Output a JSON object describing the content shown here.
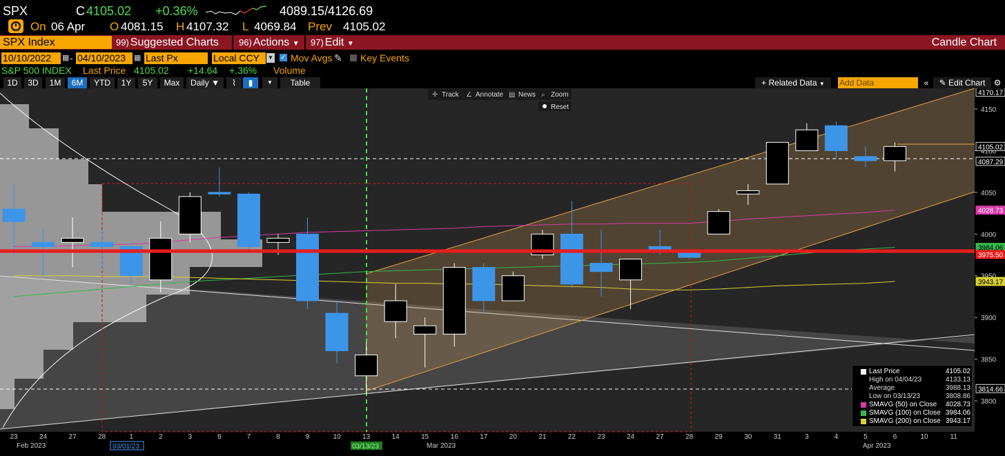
{
  "header": {
    "ticker": "SPX",
    "c_label": "C",
    "last": "4105.02",
    "change_pct": "+0.36%",
    "range": "4089.15/4126.69",
    "on_label": "On",
    "date": "06 Apr",
    "open_label": "O",
    "open": "4081.15",
    "high_label": "H",
    "high": "4107.32",
    "low_label": "L",
    "low": "4069.84",
    "prev_label": "Prev",
    "prev": "4105.02"
  },
  "menubar": {
    "security": "SPX Index",
    "suggested_num": "99)",
    "suggested": "Suggested Charts",
    "actions_num": "96)",
    "actions": "Actions",
    "edit_num": "97)",
    "edit": "Edit",
    "title": "Candle Chart"
  },
  "controls": {
    "start_date": "10/10/2022",
    "end_date": "04/10/2023",
    "field": "Last Px",
    "currency": "Local CCY",
    "mov_avgs": "Mov Avgs",
    "key_events": "Key Events"
  },
  "info": {
    "name": "S&P 500 INDEX",
    "last_price_label": "Last Price",
    "last_price": "4105.02",
    "change": "+14.64",
    "change_pct": "+.36%",
    "volume": "Volume"
  },
  "toolbar": {
    "periods": [
      "1D",
      "3D",
      "1M",
      "6M",
      "YTD",
      "1Y",
      "5Y",
      "Max"
    ],
    "active_period": "6M",
    "frequency": "Daily",
    "table": "Table",
    "related_data": "+ Related Data",
    "add_data_placeholder": "Add Data",
    "edit_chart": "Edit Chart"
  },
  "chart_tools": {
    "track": "Track",
    "annotate": "Annotate",
    "news": "News",
    "zoom": "Zoom",
    "reset": "Reset"
  },
  "colors": {
    "up": "#000000",
    "down": "#3d95e8",
    "sma50": "#d83aa6",
    "sma100": "#36b84a",
    "sma200": "#d9d036",
    "support": "#e81d1d",
    "channel": "#e8a04a",
    "accent": "#f7a600"
  },
  "chart_data": {
    "type": "candlestick",
    "x": [
      "23",
      "24",
      "27",
      "28",
      "1",
      "2",
      "3",
      "6",
      "7",
      "8",
      "9",
      "10",
      "13",
      "14",
      "15",
      "16",
      "17",
      "20",
      "21",
      "22",
      "23",
      "24",
      "27",
      "28",
      "29",
      "30",
      "31",
      "3",
      "4",
      "5",
      "6",
      "10",
      "11"
    ],
    "month_labels": [
      "Feb 2023",
      "Mar 2023",
      "Apr 2023"
    ],
    "highlight_dates": [
      "03/01/23",
      "03/13/23"
    ],
    "ylim": [
      3770,
      4175
    ],
    "yticks": [
      3800,
      3850,
      3900,
      3950,
      4000,
      4050,
      4100,
      4150
    ],
    "candles": [
      {
        "o": 4030,
        "h": 4060,
        "l": 3975,
        "c": 4015
      },
      {
        "o": 3990,
        "h": 4005,
        "l": 3950,
        "c": 3985
      },
      {
        "o": 3990,
        "h": 4020,
        "l": 3960,
        "c": 3995
      },
      {
        "o": 3990,
        "h": 4005,
        "l": 3960,
        "c": 3985
      },
      {
        "o": 3985,
        "h": 3990,
        "l": 3940,
        "c": 3950
      },
      {
        "o": 3945,
        "h": 4015,
        "l": 3930,
        "c": 3995
      },
      {
        "o": 4000,
        "h": 4050,
        "l": 3990,
        "c": 4045
      },
      {
        "o": 4050,
        "h": 4080,
        "l": 4045,
        "c": 4048
      },
      {
        "o": 4048,
        "h": 4050,
        "l": 3980,
        "c": 3985
      },
      {
        "o": 3990,
        "h": 4000,
        "l": 3975,
        "c": 3995
      },
      {
        "o": 4000,
        "h": 4020,
        "l": 3910,
        "c": 3920
      },
      {
        "o": 3905,
        "h": 3920,
        "l": 3845,
        "c": 3860
      },
      {
        "o": 3830,
        "h": 3870,
        "l": 3808,
        "c": 3855
      },
      {
        "o": 3895,
        "h": 3940,
        "l": 3875,
        "c": 3920
      },
      {
        "o": 3880,
        "h": 3900,
        "l": 3840,
        "c": 3890
      },
      {
        "o": 3880,
        "h": 3965,
        "l": 3865,
        "c": 3960
      },
      {
        "o": 3960,
        "h": 3965,
        "l": 3905,
        "c": 3920
      },
      {
        "o": 3920,
        "h": 3955,
        "l": 3920,
        "c": 3950
      },
      {
        "o": 3975,
        "h": 4005,
        "l": 3970,
        "c": 4000
      },
      {
        "o": 4000,
        "h": 4040,
        "l": 3935,
        "c": 3940
      },
      {
        "o": 3965,
        "h": 4005,
        "l": 3925,
        "c": 3955
      },
      {
        "o": 3945,
        "h": 3970,
        "l": 3910,
        "c": 3970
      },
      {
        "o": 3985,
        "h": 4005,
        "l": 3975,
        "c": 3980
      },
      {
        "o": 3980,
        "h": 3980,
        "l": 3970,
        "c": 3972
      },
      {
        "o": 4000,
        "h": 4030,
        "l": 4000,
        "c": 4027
      },
      {
        "o": 4048,
        "h": 4060,
        "l": 4035,
        "c": 4052
      },
      {
        "o": 4060,
        "h": 4110,
        "l": 4060,
        "c": 4110
      },
      {
        "o": 4100,
        "h": 4133,
        "l": 4100,
        "c": 4125
      },
      {
        "o": 4130,
        "h": 4135,
        "l": 4090,
        "c": 4100
      },
      {
        "o": 4093,
        "h": 4105,
        "l": 4080,
        "c": 4088
      },
      {
        "o": 4088,
        "h": 4110,
        "l": 4075,
        "c": 4105
      }
    ],
    "sma50": [
      3985,
      3985,
      3986,
      3987,
      3988,
      3990,
      3993,
      3996,
      3998,
      4000,
      4002,
      4003,
      4004,
      4005,
      4006,
      4007,
      4009,
      4010,
      4011,
      4012,
      4012,
      4013,
      4013,
      4013,
      4015,
      4018,
      4020,
      4022,
      4024,
      4026,
      4028.73
    ],
    "sma100": [
      3925,
      3928,
      3931,
      3934,
      3937,
      3940,
      3943,
      3945,
      3947,
      3949,
      3951,
      3953,
      3955,
      3956,
      3957,
      3958,
      3959,
      3960,
      3961,
      3962,
      3963,
      3964,
      3965,
      3966,
      3968,
      3971,
      3974,
      3977,
      3980,
      3982,
      3984.06
    ],
    "sma200": [
      3950,
      3950,
      3950,
      3949,
      3949,
      3949,
      3948,
      3947,
      3946,
      3945,
      3944,
      3943,
      3942,
      3941,
      3941,
      3940,
      3940,
      3939,
      3938,
      3937,
      3936,
      3934,
      3933,
      3933,
      3934,
      3936,
      3938,
      3939,
      3940,
      3941,
      3943.17
    ],
    "axis_badges": [
      {
        "value": 4170.17,
        "color": "#000000"
      },
      {
        "value": 4105.02,
        "color": "#000000"
      },
      {
        "value": 4087.29,
        "color": "#000000"
      },
      {
        "value": 4028.73,
        "color": "#d83aa6"
      },
      {
        "value": 3984.06,
        "color": "#36b84a"
      },
      {
        "value": 3975.5,
        "color": "#e81d1d"
      },
      {
        "value": 3943.17,
        "color": "#d9d036"
      },
      {
        "value": 3814.66,
        "color": "#000000"
      }
    ],
    "support_level": 3975.5,
    "legend": [
      {
        "label": "Last Price",
        "value": "4105.02",
        "color": "#ffffff"
      },
      {
        "label": "High on 04/04/23",
        "value": "4133.13",
        "color": ""
      },
      {
        "label": "Average",
        "value": "3988.13",
        "color": ""
      },
      {
        "label": "Low on 03/13/23",
        "value": "3808.86",
        "color": ""
      },
      {
        "label": "SMAVG (50)  on Close",
        "value": "4028.73",
        "color": "#d83aa6"
      },
      {
        "label": "SMAVG (100)  on Close",
        "value": "3984.06",
        "color": "#36b84a"
      },
      {
        "label": "SMAVG (200)  on Close",
        "value": "3943.17",
        "color": "#d9d036"
      }
    ]
  }
}
